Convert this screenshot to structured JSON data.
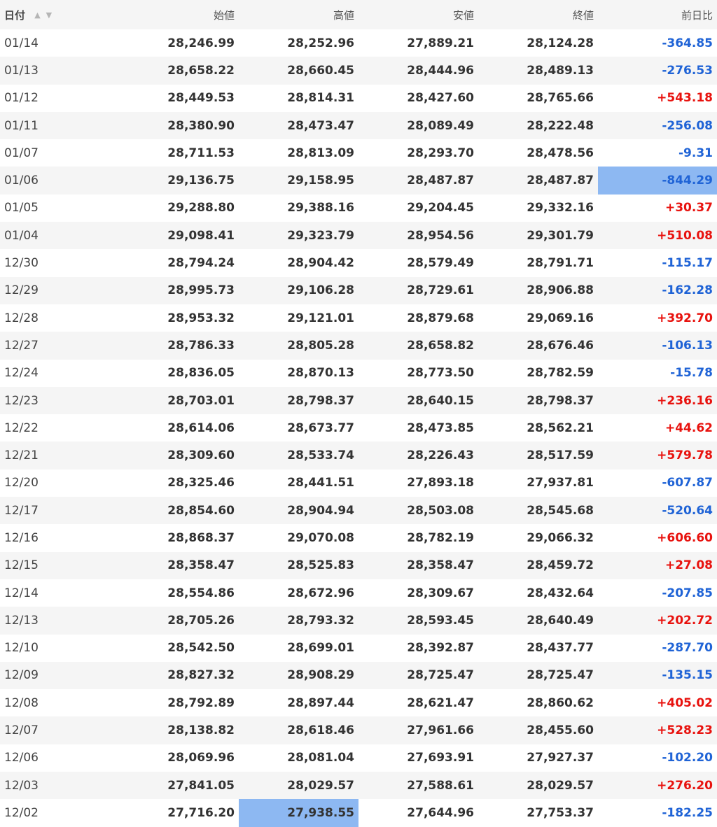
{
  "table": {
    "headers": {
      "date": "日付",
      "open": "始値",
      "high": "高値",
      "low": "安値",
      "close": "終値",
      "change": "前日比"
    },
    "sort_icons": {
      "asc": "▲",
      "desc": "▼"
    },
    "highlight_color": "#8db8f2",
    "up_color": "#e8120e",
    "down_color": "#1f63d6",
    "rows": [
      [
        "01/14",
        "28,246.99",
        "28,252.96",
        "27,889.21",
        "28,124.28",
        "-364.85"
      ],
      [
        "01/13",
        "28,658.22",
        "28,660.45",
        "28,444.96",
        "28,489.13",
        "-276.53"
      ],
      [
        "01/12",
        "28,449.53",
        "28,814.31",
        "28,427.60",
        "28,765.66",
        "+543.18"
      ],
      [
        "01/11",
        "28,380.90",
        "28,473.47",
        "28,089.49",
        "28,222.48",
        "-256.08"
      ],
      [
        "01/07",
        "28,711.53",
        "28,813.09",
        "28,293.70",
        "28,478.56",
        "-9.31"
      ],
      [
        "01/06",
        "29,136.75",
        "29,158.95",
        "28,487.87",
        "28,487.87",
        "-844.29"
      ],
      [
        "01/05",
        "29,288.80",
        "29,388.16",
        "29,204.45",
        "29,332.16",
        "+30.37"
      ],
      [
        "01/04",
        "29,098.41",
        "29,323.79",
        "28,954.56",
        "29,301.79",
        "+510.08"
      ],
      [
        "12/30",
        "28,794.24",
        "28,904.42",
        "28,579.49",
        "28,791.71",
        "-115.17"
      ],
      [
        "12/29",
        "28,995.73",
        "29,106.28",
        "28,729.61",
        "28,906.88",
        "-162.28"
      ],
      [
        "12/28",
        "28,953.32",
        "29,121.01",
        "28,879.68",
        "29,069.16",
        "+392.70"
      ],
      [
        "12/27",
        "28,786.33",
        "28,805.28",
        "28,658.82",
        "28,676.46",
        "-106.13"
      ],
      [
        "12/24",
        "28,836.05",
        "28,870.13",
        "28,773.50",
        "28,782.59",
        "-15.78"
      ],
      [
        "12/23",
        "28,703.01",
        "28,798.37",
        "28,640.15",
        "28,798.37",
        "+236.16"
      ],
      [
        "12/22",
        "28,614.06",
        "28,673.77",
        "28,473.85",
        "28,562.21",
        "+44.62"
      ],
      [
        "12/21",
        "28,309.60",
        "28,533.74",
        "28,226.43",
        "28,517.59",
        "+579.78"
      ],
      [
        "12/20",
        "28,325.46",
        "28,441.51",
        "27,893.18",
        "27,937.81",
        "-607.87"
      ],
      [
        "12/17",
        "28,854.60",
        "28,904.94",
        "28,503.08",
        "28,545.68",
        "-520.64"
      ],
      [
        "12/16",
        "28,868.37",
        "29,070.08",
        "28,782.19",
        "29,066.32",
        "+606.60"
      ],
      [
        "12/15",
        "28,358.47",
        "28,525.83",
        "28,358.47",
        "28,459.72",
        "+27.08"
      ],
      [
        "12/14",
        "28,554.86",
        "28,672.96",
        "28,309.67",
        "28,432.64",
        "-207.85"
      ],
      [
        "12/13",
        "28,705.26",
        "28,793.32",
        "28,593.45",
        "28,640.49",
        "+202.72"
      ],
      [
        "12/10",
        "28,542.50",
        "28,699.01",
        "28,392.87",
        "28,437.77",
        "-287.70"
      ],
      [
        "12/09",
        "28,827.32",
        "28,908.29",
        "28,725.47",
        "28,725.47",
        "-135.15"
      ],
      [
        "12/08",
        "28,792.89",
        "28,897.44",
        "28,621.47",
        "28,860.62",
        "+405.02"
      ],
      [
        "12/07",
        "28,138.82",
        "28,618.46",
        "27,961.66",
        "28,455.60",
        "+528.23"
      ],
      [
        "12/06",
        "28,069.96",
        "28,081.04",
        "27,693.91",
        "27,927.37",
        "-102.20"
      ],
      [
        "12/03",
        "27,841.05",
        "28,029.57",
        "27,588.61",
        "28,029.57",
        "+276.20"
      ],
      [
        "12/02",
        "27,716.20",
        "27,938.55",
        "27,644.96",
        "27,753.37",
        "-182.25"
      ]
    ],
    "selected_cells": [
      {
        "row": 5,
        "col": 5
      },
      {
        "row": 28,
        "col": 2
      }
    ]
  }
}
